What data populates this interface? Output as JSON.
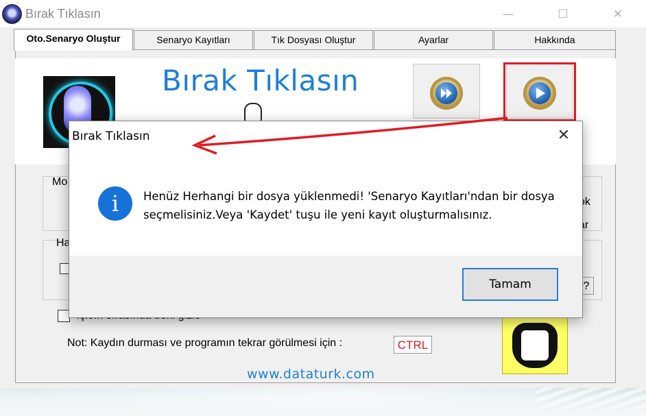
{
  "window": {
    "title": "Bırak Tıklasın"
  },
  "tabs": [
    {
      "label": "Oto.Senaryo Oluştur",
      "active": true
    },
    {
      "label": "Senaryo Kayıtları",
      "active": false
    },
    {
      "label": "Tık Dosyası Oluştur",
      "active": false
    },
    {
      "label": "Ayarlar",
      "active": false
    },
    {
      "label": "Hakkında",
      "active": false
    }
  ],
  "header": {
    "brand": "Bırak Tıklasın"
  },
  "main": {
    "group1_partial": "Mo",
    "group2_partial": "Ha",
    "right_partial_1": "ok",
    "right_partial_2": "ar",
    "hide_checkbox_label": "İşlem sırasında beni gizle",
    "note_label": "Not: Kaydın durması ve programın tekrar görülmesi için :",
    "stop_key": "CTRL",
    "help_button": "?",
    "website": "www.dataturk.com"
  },
  "dialog": {
    "title": "Bırak Tıklasın",
    "message": "Henüz Herhangi bir dosya yüklenmedi! 'Senaryo Kayıtları'ndan bir dosya seçmelisiniz.Veya 'Kaydet' tuşu ile yeni kayıt oluşturmalısınız.",
    "ok_label": "Tamam",
    "close_glyph": "✕",
    "icon_glyph": "i"
  },
  "colors": {
    "accent": "#1e7fd6",
    "highlight": "#e01b24",
    "info": "#1672d8"
  }
}
